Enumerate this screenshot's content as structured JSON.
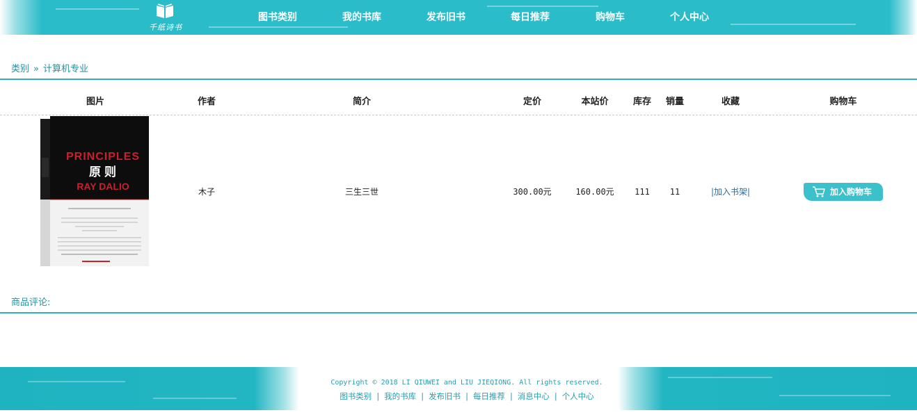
{
  "header": {
    "logo_text": "千纸诗书",
    "nav": [
      "图书类别",
      "我的书库",
      "发布旧书",
      "每日推荐",
      "购物车",
      "个人中心"
    ]
  },
  "breadcrumb": {
    "root": "类别",
    "separator": "»",
    "current": "计算机专业"
  },
  "table": {
    "headers": {
      "image": "图片",
      "author": "作者",
      "intro": "简介",
      "list_price": "定价",
      "site_price": "本站价",
      "stock": "库存",
      "sales": "销量",
      "favorite": "收藏",
      "cart": "购物车"
    },
    "row": {
      "cover": {
        "title_en": "PRINCIPLES",
        "title_cn": "原则",
        "author_en": "RAY DALIO"
      },
      "author": "木子",
      "intro": "三生三世",
      "list_price": "300.00元",
      "site_price": "160.00元",
      "stock": "111",
      "sales": "11",
      "favorite_link": "|加入书架|",
      "cart_button": "加入购物车"
    }
  },
  "comments": {
    "title": "商品评论:"
  },
  "footer": {
    "copyright": "Copyright © 2018 LI QIUWEI and LIU JIEQIONG. All rights reserved.",
    "links": [
      "图书类别",
      "我的书库",
      "发布旧书",
      "每日推荐",
      "消息中心",
      "个人中心"
    ]
  },
  "colors": {
    "accent": "#2bbcc9",
    "link": "#2a8fa0",
    "cover_red": "#c8202c"
  }
}
